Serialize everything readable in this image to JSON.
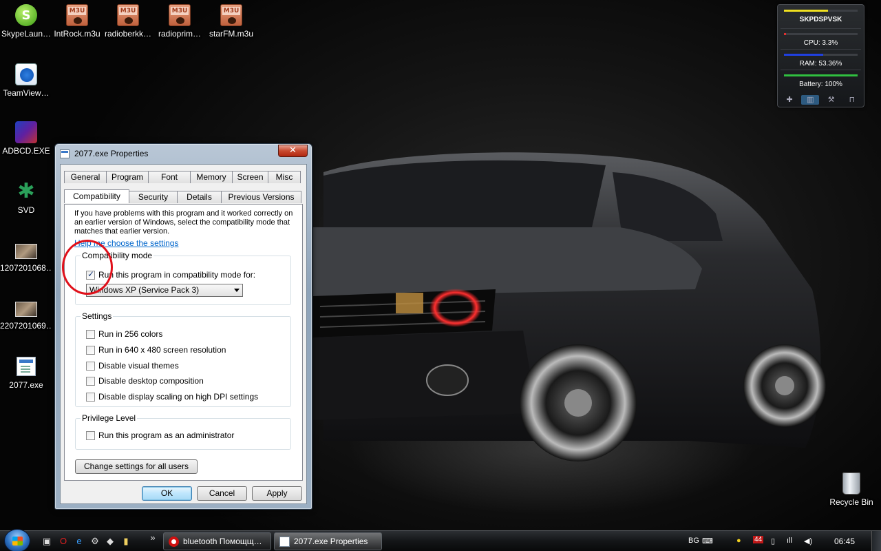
{
  "desktop_icons": [
    {
      "label": "SkypeLaun…",
      "icon": "skype-icon"
    },
    {
      "label": "IntRock.m3u",
      "icon": "m3u-file-icon"
    },
    {
      "label": "radioberkk…",
      "icon": "m3u-file-icon"
    },
    {
      "label": "radioprim…",
      "icon": "m3u-file-icon"
    },
    {
      "label": "starFM.m3u",
      "icon": "m3u-file-icon"
    },
    {
      "label": "TeamView…",
      "icon": "teamviewer-icon"
    },
    {
      "label": "ADBCD.EXE",
      "icon": "adbcd-icon"
    },
    {
      "label": "SVD",
      "icon": "spider-icon"
    },
    {
      "label": "1207201068…",
      "icon": "photo-icon"
    },
    {
      "label": "2207201069…",
      "icon": "photo-icon"
    },
    {
      "label": "2077.exe",
      "icon": "exe-icon"
    },
    {
      "label": "Recycle Bin",
      "icon": "recycle-bin-icon"
    }
  ],
  "gadget": {
    "host": "SKPDSPVSK",
    "cpu": "CPU: 3.3%",
    "ram": "RAM: 53.36%",
    "battery": "Battery: 100%",
    "host_level": 0.6,
    "cpu_level": 0.033,
    "ram_level": 0.5336,
    "battery_level": 1.0,
    "colors": {
      "host": "#f0e020",
      "cpu": "#e03030",
      "ram": "#2040e0",
      "battery": "#30c040"
    }
  },
  "dialog": {
    "title": "2077.exe Properties",
    "close": "✕",
    "tabs_row1": [
      "General",
      "Program",
      "Font",
      "Memory",
      "Screen",
      "Misc"
    ],
    "tabs_row2": [
      "Compatibility",
      "Security",
      "Details",
      "Previous Versions"
    ],
    "intro": "If you have problems with this program and it worked correctly on an earlier version of Windows, select the compatibility mode that matches that earlier version.",
    "help_link": "Help me choose the settings",
    "compat_group": {
      "legend": "Compatibility mode",
      "checkbox": "Run this program in compatibility mode for:",
      "checked": true,
      "selected_mode": "Windows XP (Service Pack 3)"
    },
    "settings_group": {
      "legend": "Settings",
      "items": [
        "Run in 256 colors",
        "Run in 640 x 480 screen resolution",
        "Disable visual themes",
        "Disable desktop composition",
        "Disable display scaling on high DPI settings"
      ]
    },
    "privilege_group": {
      "legend": "Privilege Level",
      "item": "Run this program as an administrator"
    },
    "change_all_users": "Change settings for all users",
    "ok": "OK",
    "cancel": "Cancel",
    "apply": "Apply"
  },
  "taskbar": {
    "overflow": "»",
    "tasks": [
      {
        "label": "bluetooth Помощщ…",
        "icon": "opera-icon"
      },
      {
        "label": "2077.exe Properties",
        "icon": "exe-icon"
      }
    ],
    "language": "BG",
    "notification_badge": "44",
    "clock": "06:45"
  }
}
